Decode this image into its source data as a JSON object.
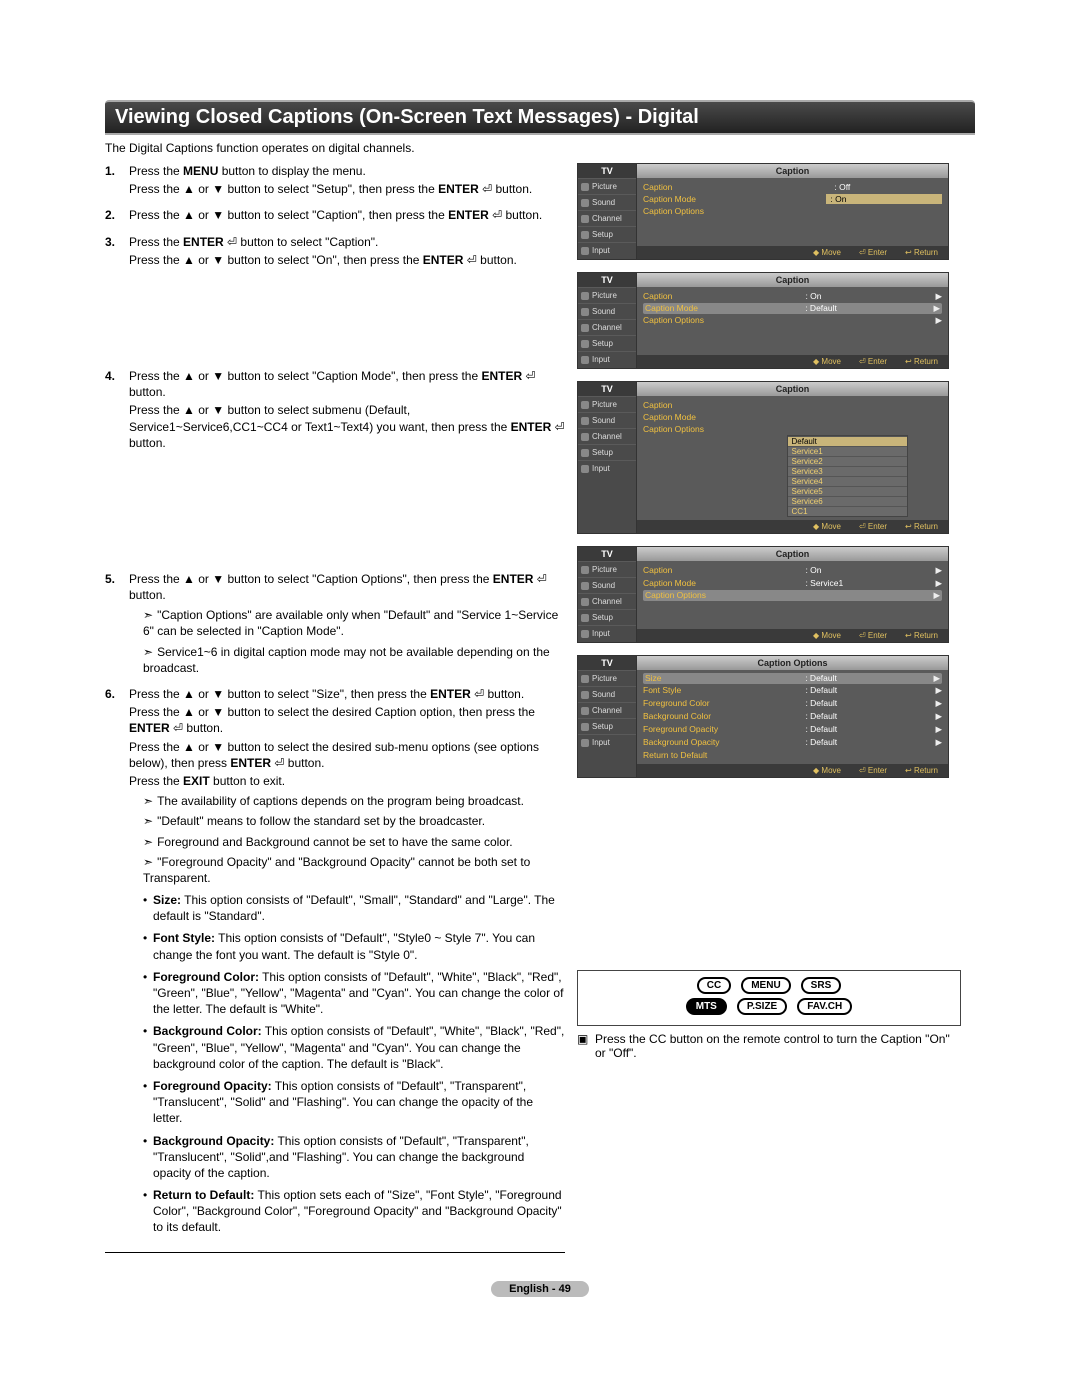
{
  "title": "Viewing Closed Captions (On-Screen Text Messages) - Digital",
  "intro": "The Digital Captions function operates on digital channels.",
  "steps": {
    "s1": {
      "num": "1.",
      "l1a": "Press the ",
      "l1b": "MENU",
      "l1c": " button to display the menu.",
      "l2": "Press the ▲ or ▼ button to select \"Setup\", then press the ",
      "l2b": "ENTER",
      "l2c": " ⏎ button."
    },
    "s2": {
      "num": "2.",
      "l1": "Press the ▲ or ▼ button to select \"Caption\", then press the ",
      "l1b": "ENTER",
      "l1c": " ⏎ button."
    },
    "s3": {
      "num": "3.",
      "l1a": "Press the ",
      "l1b": "ENTER",
      "l1c": " ⏎ button to select \"Caption\".",
      "l2": "Press the ▲ or ▼ button to select \"On\", then press the ",
      "l2b": "ENTER",
      "l2c": " ⏎ button."
    },
    "s4": {
      "num": "4.",
      "l1": "Press the ▲ or ▼ button to select \"Caption Mode\", then press the ",
      "l1b": "ENTER",
      "l1c": " ⏎ button.",
      "l2": "Press the ▲ or ▼ button to select submenu (Default, Service1~Service6,CC1~CC4 or Text1~Text4) you want, then press the ",
      "l2b": "ENTER",
      "l2c": " ⏎ button."
    },
    "s5": {
      "num": "5.",
      "l1": "Press the ▲ or ▼ button to select \"Caption Options\", then press the ",
      "l1b": "ENTER",
      "l1c": " ⏎ button.",
      "n1": "\"Caption Options\" are available only when \"Default\" and \"Service 1~Service 6\" can be selected in \"Caption Mode\".",
      "n2": "Service1~6 in digital caption mode may not be available depending on the broadcast."
    },
    "s6": {
      "num": "6.",
      "l1": "Press the ▲ or ▼ button to select \"Size\", then press the ",
      "l1b": "ENTER",
      "l1c": " ⏎ button.",
      "l2": "Press the ▲ or ▼ button to select the desired Caption option, then press the ",
      "l2b": "ENTER",
      "l2c": " ⏎ button.",
      "l3": "Press the ▲ or ▼ button to select the desired sub-menu options (see options below), then press ",
      "l3b": "ENTER",
      "l3c": " ⏎ button.",
      "exit": "Press the ",
      "exitb": "EXIT",
      "exitc": " button to exit.",
      "nn1": "The availability of captions depends on the program being broadcast.",
      "nn2": "\"Default\" means to follow the standard set by the broadcaster.",
      "nn3": "Foreground and Background cannot be set to have the same color.",
      "nn4": "\"Foreground Opacity\" and \"Background Opacity\" cannot be both set to Transparent."
    }
  },
  "options": {
    "size": {
      "t": "Size:",
      "d": " This option consists of \"Default\", \"Small\", \"Standard\" and \"Large\". The default is \"Standard\"."
    },
    "font": {
      "t": "Font Style:",
      "d": " This option consists of \"Default\", \"Style0 ~ Style 7\". You can change the font you want. The default is \"Style 0\"."
    },
    "fg": {
      "t": "Foreground Color:",
      "d": " This option consists of \"Default\", \"White\", \"Black\", \"Red\", \"Green\", \"Blue\", \"Yellow\", \"Magenta\" and \"Cyan\". You can change the color of the letter. The default is \"White\"."
    },
    "bg": {
      "t": "Background Color:",
      "d": " This option consists of \"Default\", \"White\", \"Black\", \"Red\", \"Green\", \"Blue\", \"Yellow\", \"Magenta\" and \"Cyan\". You can change the background color of the caption. The default is \"Black\"."
    },
    "fgo": {
      "t": "Foreground Opacity:",
      "d": " This option consists of \"Default\", \"Transparent\", \"Translucent\", \"Solid\" and \"Flashing\". You can change the opacity of the letter."
    },
    "bgo": {
      "t": "Background Opacity:",
      "d": " This option consists of \"Default\", \"Transparent\", \"Translucent\", \"Solid\",and \"Flashing\". You can change the background opacity of the caption."
    },
    "rtd": {
      "t": "Return to Default:",
      "d": " This option sets each of \"Size\", \"Font Style\", \"Foreground Color\", \"Background Color\", \"Foreground Opacity\" and \"Background Opacity\" to its default."
    }
  },
  "osd": {
    "tv": "TV",
    "side": {
      "picture": "Picture",
      "sound": "Sound",
      "channel": "Channel",
      "setup": "Setup",
      "input": "Input"
    },
    "foot": {
      "move": "Move",
      "enter": "Enter",
      "ret": "Return"
    },
    "m1": {
      "title": "Caption",
      "caption": {
        "l": "Caption",
        "v": ": Off"
      },
      "mode": {
        "l": "Caption Mode",
        "v": ": On"
      },
      "opts": {
        "l": "Caption Options"
      }
    },
    "m2": {
      "title": "Caption",
      "caption": {
        "l": "Caption",
        "v": ": On"
      },
      "mode": {
        "l": "Caption Mode",
        "v": ": Default"
      },
      "opts": {
        "l": "Caption Options"
      }
    },
    "m3": {
      "title": "Caption",
      "caption": {
        "l": "Caption"
      },
      "mode": {
        "l": "Caption Mode"
      },
      "opts": {
        "l": "Caption Options"
      },
      "list": {
        "default": "Default",
        "s1": "Service1",
        "s2": "Service2",
        "s3": "Service3",
        "s4": "Service4",
        "s5": "Service5",
        "s6": "Service6",
        "cc1": "CC1"
      }
    },
    "m4": {
      "title": "Caption",
      "caption": {
        "l": "Caption",
        "v": ": On"
      },
      "mode": {
        "l": "Caption Mode",
        "v": ": Service1"
      },
      "opts": {
        "l": "Caption Options"
      }
    },
    "m5": {
      "title": "Caption Options",
      "size": {
        "l": "Size",
        "v": ": Default"
      },
      "font": {
        "l": "Font Style",
        "v": ": Default"
      },
      "fg": {
        "l": "Foreground Color",
        "v": ": Default"
      },
      "bg": {
        "l": "Background Color",
        "v": ": Default"
      },
      "fgo": {
        "l": "Foreground Opacity",
        "v": ": Default"
      },
      "bgo": {
        "l": "Background Opacity",
        "v": ": Default"
      },
      "rtd": {
        "l": "Return to Default"
      }
    }
  },
  "remote": {
    "cc": "CC",
    "menu": "MENU",
    "srs": "SRS",
    "mts": "MTS",
    "psize": "P.SIZE",
    "fav": "FAV.CH",
    "note": "Press the CC button on the remote control to turn the Caption \"On\" or \"Off\"."
  },
  "footer": "English - 49"
}
